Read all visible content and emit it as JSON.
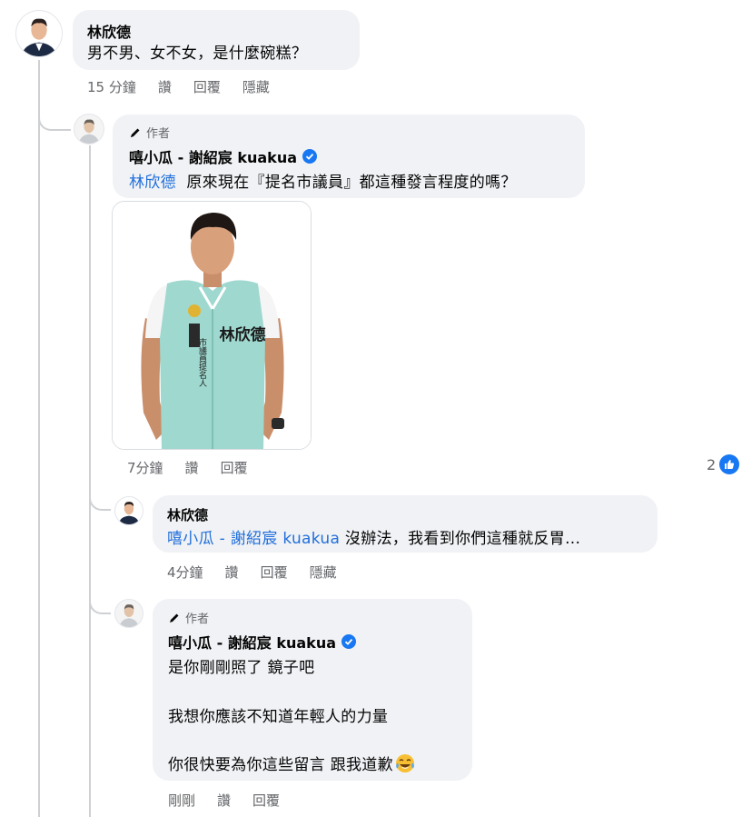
{
  "comments": [
    {
      "author": "林欣德",
      "text": "男不男、女不女，是什麼碗糕？",
      "time": "15 分鐘",
      "actions": [
        "讚",
        "回覆",
        "隱藏"
      ]
    },
    {
      "author_badge": "作者",
      "author": "嘻小瓜 - 謝紹宸 kuakua",
      "mention": "林欣德",
      "text": "原來現在『提名市議員』都這種發言程度的嗎？",
      "time": "7分鐘",
      "actions": [
        "讚",
        "回覆"
      ],
      "reaction_count": "2",
      "photo": {
        "vest_name": "林欣德",
        "vest_title": "市議員提名人"
      }
    },
    {
      "author": "林欣德",
      "mention": "嘻小瓜 - 謝紹宸 kuakua",
      "text": "沒辦法，我看到你們這種就反胃...",
      "time": "4分鐘",
      "actions": [
        "讚",
        "回覆",
        "隱藏"
      ]
    },
    {
      "author_badge": "作者",
      "author": "嘻小瓜 - 謝紹宸 kuakua",
      "lines": [
        "是你剛剛照了 鏡子吧",
        "我想你應該不知道年輕人的力量",
        "你很快要為你這些留言 跟我道歉"
      ],
      "emoji": "tears-of-joy-emoji",
      "time": "剛剛",
      "actions": [
        "讚",
        "回覆"
      ]
    }
  ],
  "colors": {
    "bubble": "#f0f2f5",
    "mention": "#216fdb",
    "meta": "#65676b",
    "like": "#1877f2",
    "vest": "#9fd8cf"
  }
}
